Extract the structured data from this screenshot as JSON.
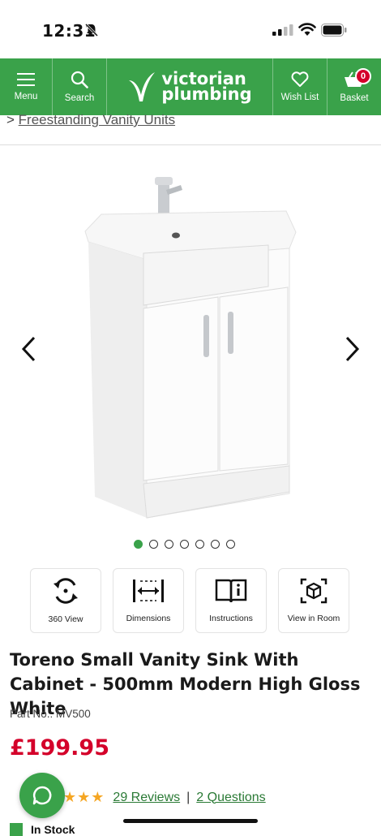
{
  "status": {
    "time": "12:31"
  },
  "nav": {
    "menu_label": "Menu",
    "search_label": "Search",
    "brand_line1": "victorian",
    "brand_line2": "plumbing",
    "wishlist_label": "Wish List",
    "basket_label": "Basket",
    "basket_count": "0",
    "accent_color": "#3aa24a"
  },
  "breadcrumb": {
    "arrow": ">",
    "link": "Freestanding Vanity Units"
  },
  "gallery": {
    "image_count": 7,
    "active_index": 0
  },
  "tools": [
    {
      "label": "360 View",
      "icon": "rotate-360-icon"
    },
    {
      "label": "Dimensions",
      "icon": "dimensions-icon"
    },
    {
      "label": "Instructions",
      "icon": "book-info-icon"
    },
    {
      "label": "View in Room",
      "icon": "ar-cube-icon"
    }
  ],
  "product": {
    "title": "Toreno Small Vanity Sink With Cabinet - 500mm Modern High Gloss White",
    "part_no": "Part No.: MV500",
    "price": "£199.95",
    "price_color": "#d4002a",
    "stars": "★★★",
    "reviews": "29 Reviews",
    "separator": "|",
    "questions": "2 Questions",
    "stock": "In Stock"
  }
}
